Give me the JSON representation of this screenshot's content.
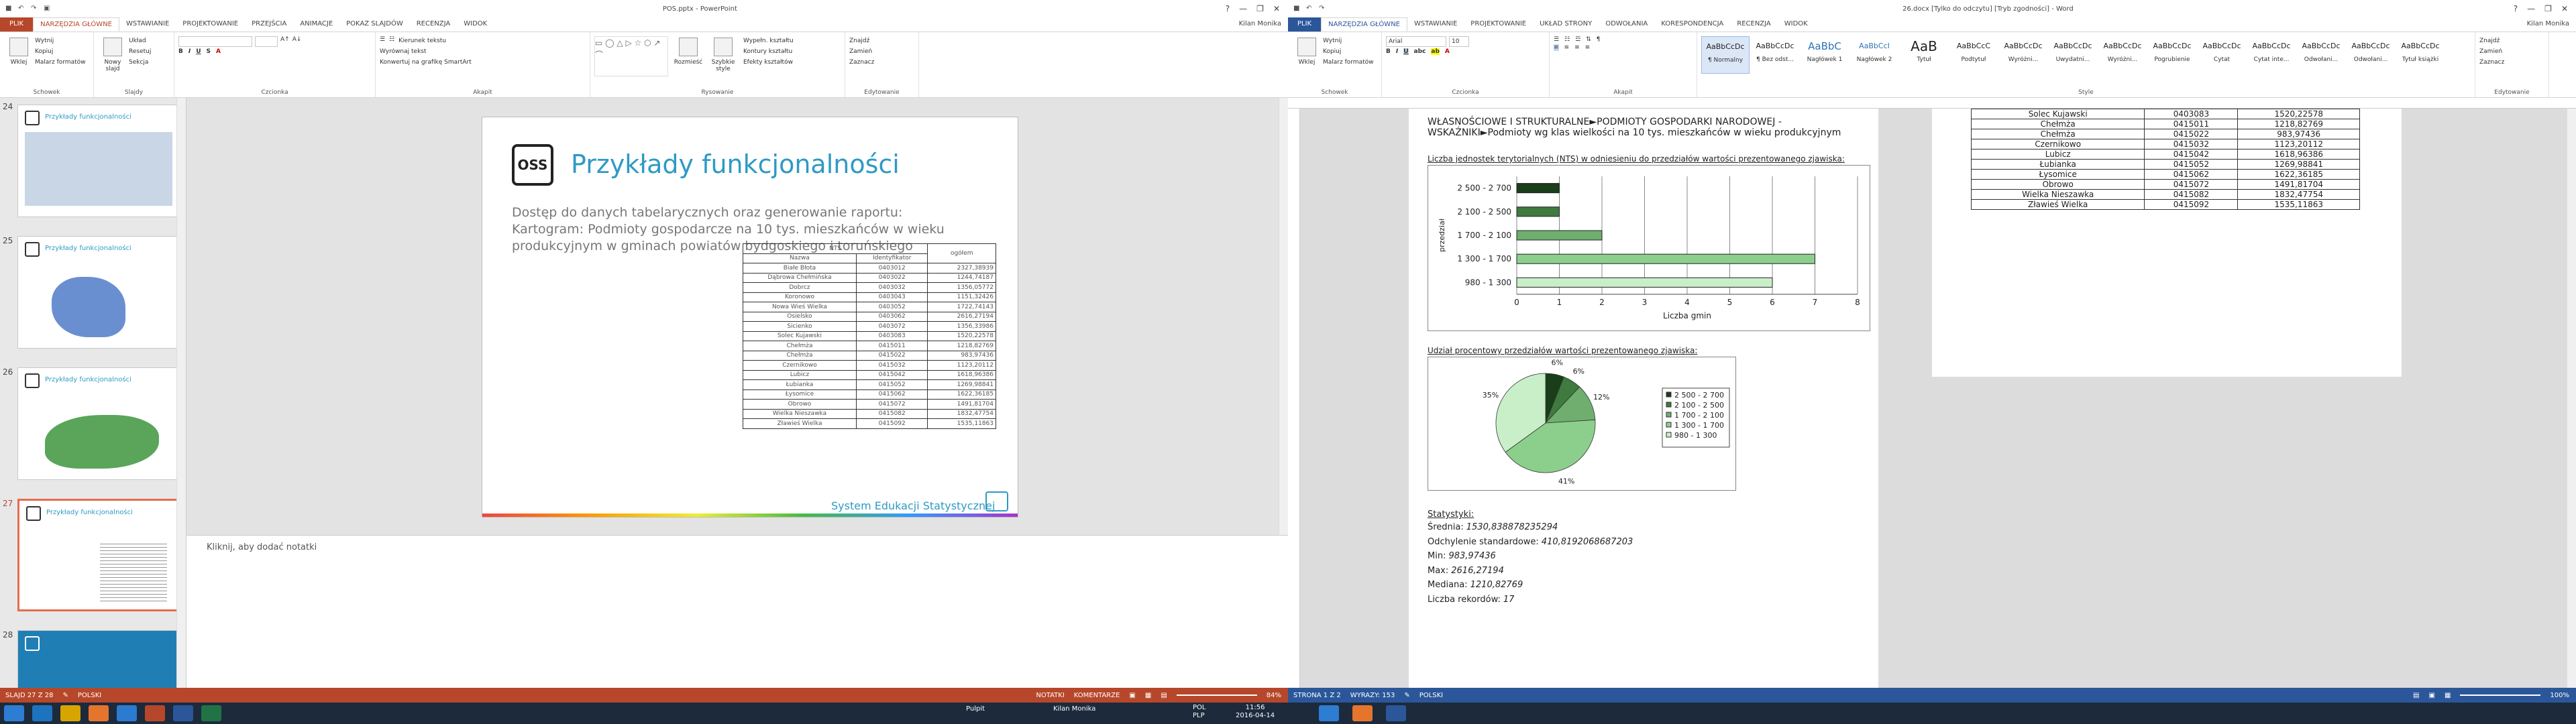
{
  "ppt": {
    "title": "POS.pptx - PowerPoint",
    "user": "Kilan Monika",
    "tabs": [
      "PLIK",
      "NARZĘDZIA GŁÓWNE",
      "WSTAWIANIE",
      "PROJEKTOWANIE",
      "PRZEJŚCIA",
      "ANIMACJE",
      "POKAZ SLAJDÓW",
      "RECENZJA",
      "WIDOK"
    ],
    "ribbon": {
      "clipboard": {
        "label": "Schowek",
        "paste": "Wklej",
        "cut": "Wytnij",
        "copy": "Kopiuj",
        "painter": "Malarz formatów"
      },
      "slides": {
        "label": "Slajdy",
        "new": "Nowy slajd",
        "layout": "Układ",
        "reset": "Resetuj",
        "section": "Sekcja"
      },
      "font": {
        "label": "Czcionka"
      },
      "paragraph": {
        "label": "Akapit",
        "dir": "Kierunek tekstu",
        "align": "Wyrównaj tekst",
        "smartart": "Konwertuj na grafikę SmartArt"
      },
      "drawing": {
        "label": "Rysowanie",
        "arrange": "Rozmieść",
        "styles": "Szybkie style",
        "fill": "Wypełn. kształtu",
        "outline": "Kontury kształtu",
        "effects": "Efekty kształtów"
      },
      "editing": {
        "label": "Edytowanie",
        "find": "Znajdź",
        "replace": "Zamień",
        "select": "Zaznacz"
      }
    },
    "thumb_numbers": [
      "24",
      "25",
      "26",
      "27",
      "28"
    ],
    "thumb_title": "Przykłady funkcjonalności",
    "slide": {
      "title": "Przykłady funkcjonalności",
      "logo": "OSS",
      "text1": "Dostęp do danych tabelarycznych oraz generowanie raportu:",
      "text2": "Kartogram: Podmioty gospodarcze na 10 tys. mieszkańców w wieku produkcyjnym w gminach powiatów bydgoskiego i toruńskiego",
      "table": {
        "group_header": "NTS",
        "col_name": "Nazwa",
        "col_id": "Identyfikator",
        "col_total": "ogółem",
        "rows": [
          [
            "Białe Błota",
            "0403012",
            "2327,38939"
          ],
          [
            "Dąbrowa Chełmińska",
            "0403022",
            "1244,74187"
          ],
          [
            "Dobrcz",
            "0403032",
            "1356,05772"
          ],
          [
            "Koronowo",
            "0403043",
            "1151,32426"
          ],
          [
            "Nowa Wieś Wielka",
            "0403052",
            "1722,74143"
          ],
          [
            "Osielsko",
            "0403062",
            "2616,27194"
          ],
          [
            "Sicienko",
            "0403072",
            "1356,33986"
          ],
          [
            "Solec Kujawski",
            "0403083",
            "1520,22578"
          ],
          [
            "Chełmża",
            "0415011",
            "1218,82769"
          ],
          [
            "Chełmża",
            "0415022",
            "983,97436"
          ],
          [
            "Czernikowo",
            "0415032",
            "1123,20112"
          ],
          [
            "Lubicz",
            "0415042",
            "1618,96386"
          ],
          [
            "Łubianka",
            "0415052",
            "1269,98841"
          ],
          [
            "Łysomice",
            "0415062",
            "1622,36185"
          ],
          [
            "Obrowo",
            "0415072",
            "1491,81704"
          ],
          [
            "Wielka Nieszawka",
            "0415082",
            "1832,47754"
          ],
          [
            "Zławieś Wielka",
            "0415092",
            "1535,11863"
          ]
        ]
      },
      "footer": "System Edukacji Statystycznej"
    },
    "notes": "Kliknij, aby dodać notatki",
    "status": {
      "slide": "SLAJD 27 Z 28",
      "lang": "POLSKI",
      "notes": "NOTATKI",
      "comments": "KOMENTARZE",
      "zoom": "84%"
    }
  },
  "word": {
    "title": "26.docx [Tylko do odczytu] [Tryb zgodności] - Word",
    "user": "Kilan Monika",
    "tabs": [
      "PLIK",
      "NARZĘDZIA GŁÓWNE",
      "WSTAWIANIE",
      "PROJEKTOWANIE",
      "UKŁAD STRONY",
      "ODWOŁANIA",
      "KORESPONDENCJA",
      "RECENZJA",
      "WIDOK"
    ],
    "ribbon": {
      "clipboard": {
        "label": "Schowek",
        "paste": "Wklej",
        "cut": "Wytnij",
        "copy": "Kopiuj",
        "painter": "Malarz formatów"
      },
      "font": {
        "label": "Czcionka",
        "name": "Arial",
        "size": "10"
      },
      "paragraph": {
        "label": "Akapit"
      },
      "styles": {
        "label": "Style",
        "items": [
          {
            "preview": "AaBbCcDc",
            "name": "¶ Normalny"
          },
          {
            "preview": "AaBbCcDc",
            "name": "¶ Bez odst..."
          },
          {
            "preview": "AaBbC",
            "name": "Nagłówek 1"
          },
          {
            "preview": "AaBbCcI",
            "name": "Nagłówek 2"
          },
          {
            "preview": "AaB",
            "name": "Tytuł"
          },
          {
            "preview": "AaBbCcC",
            "name": "Podtytuł"
          },
          {
            "preview": "AaBbCcDc",
            "name": "Wyróżni..."
          },
          {
            "preview": "AaBbCcDc",
            "name": "Uwydatni..."
          },
          {
            "preview": "AaBbCcDc",
            "name": "Wyróżni..."
          },
          {
            "preview": "AaBbCcDc",
            "name": "Pogrubienie"
          },
          {
            "preview": "AaBbCcDc",
            "name": "Cytat"
          },
          {
            "preview": "AaBbCcDc",
            "name": "Cytat inte..."
          },
          {
            "preview": "AaBbCcDc",
            "name": "Odwołani..."
          },
          {
            "preview": "AaBbCcDc",
            "name": "Odwołani..."
          },
          {
            "preview": "AaBbCcDc",
            "name": "Tytuł książki"
          }
        ]
      },
      "editing": {
        "label": "Edytowanie",
        "find": "Znajdź",
        "replace": "Zamień",
        "select": "Zaznacz"
      }
    },
    "doc": {
      "heading1": "WŁASNOŚCIOWE I STRUKTURALNE►PODMIOTY GOSPODARKI NARODOWEJ -",
      "heading2": "WSKAŹNIKI►Podmioty wg klas wielkości na 10 tys. mieszkańców w wieku produkcyjnym",
      "bar_title": "Liczba jednostek terytorialnych (NTS) w odniesieniu do przedziałów wartości prezentowanego zjawiska:",
      "pie_title": "Udział procentowy przedziałów wartości prezentowanego zjawiska:",
      "stats_title": "Statystyki:",
      "stats": [
        {
          "label": "Średnia:",
          "value": "1530,838878235294"
        },
        {
          "label": "Odchylenie standardowe:",
          "value": "410,8192068687203"
        },
        {
          "label": "Min:",
          "value": "983,97436"
        },
        {
          "label": "Max:",
          "value": "2616,27194"
        },
        {
          "label": "Mediana:",
          "value": "1210,82769"
        },
        {
          "label": "Liczba rekordów:",
          "value": "17"
        }
      ],
      "table2": [
        [
          "Solec Kujawski",
          "0403083",
          "1520,22578"
        ],
        [
          "Chełmża",
          "0415011",
          "1218,82769"
        ],
        [
          "Chełmża",
          "0415022",
          "983,97436"
        ],
        [
          "Czernikowo",
          "0415032",
          "1123,20112"
        ],
        [
          "Lubicz",
          "0415042",
          "1618,96386"
        ],
        [
          "Łubianka",
          "0415052",
          "1269,98841"
        ],
        [
          "Łysomice",
          "0415062",
          "1622,36185"
        ],
        [
          "Obrowo",
          "0415072",
          "1491,81704"
        ],
        [
          "Wielka Nieszawka",
          "0415082",
          "1832,47754"
        ],
        [
          "Zławieś Wielka",
          "0415092",
          "1535,11863"
        ]
      ]
    },
    "status": {
      "page": "STRONA 1 Z 2",
      "words": "WYRAZY: 153",
      "lang": "POLSKI",
      "zoom": "100%"
    }
  },
  "chart_data": [
    {
      "type": "bar",
      "orientation": "horizontal",
      "categories": [
        "980 - 1 300",
        "1 300 - 1 700",
        "1 700 - 2 100",
        "2 100 - 2 500",
        "2 500 - 2 700"
      ],
      "values": [
        6,
        7,
        2,
        1,
        1
      ],
      "xlabel": "Liczba gmin",
      "ylabel": "przedział",
      "xlim": [
        0,
        8
      ],
      "xticks": [
        0,
        1,
        2,
        3,
        4,
        5,
        6,
        7,
        8
      ],
      "grid": true
    },
    {
      "type": "pie",
      "labels": [
        "2 500 - 2 700",
        "2 100 - 2 500",
        "1 700 - 2 100",
        "1 300 - 1 700",
        "980 - 1 300"
      ],
      "values": [
        6,
        6,
        12,
        41,
        35
      ],
      "value_labels": [
        "6%",
        "6%",
        "12%",
        "41%",
        "35%"
      ],
      "colors": [
        "#1a3d1a",
        "#3f7a3f",
        "#6fae6f",
        "#8ccf8c",
        "#c9efc9"
      ],
      "legend": "right"
    }
  ],
  "taskbar": {
    "time": "11:56",
    "date": "2016-04-14",
    "lang1": "POL",
    "lang2": "PLP",
    "user": "Kilan Monika",
    "tray_label": "Pulpit"
  }
}
